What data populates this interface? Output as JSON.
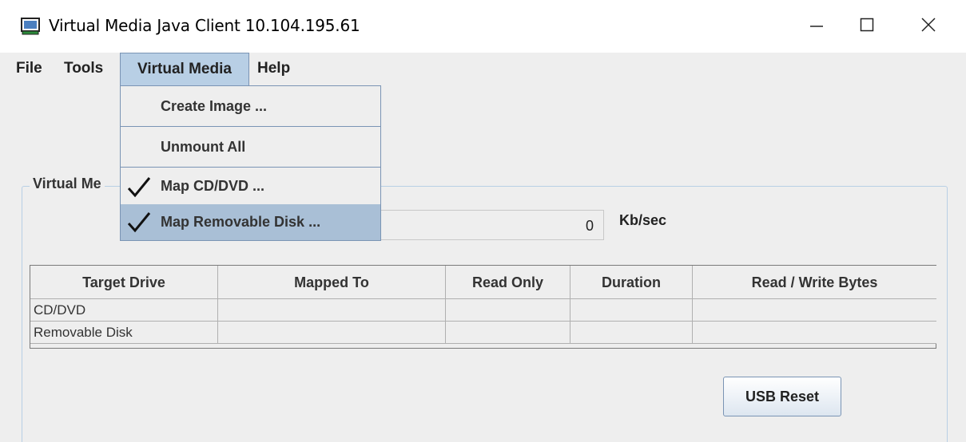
{
  "window": {
    "title": "Virtual Media Java Client 10.104.195.61"
  },
  "menubar": {
    "items": [
      {
        "label": "File"
      },
      {
        "label": "Tools"
      },
      {
        "label": "Virtual Media"
      },
      {
        "label": "Help"
      }
    ]
  },
  "dropdown": {
    "items": [
      {
        "label": "Create Image ...",
        "checked": false
      },
      {
        "label": "Unmount All",
        "checked": false
      },
      {
        "label": "Map CD/DVD ...",
        "checked": true
      },
      {
        "label": "Map Removable Disk ...",
        "checked": true,
        "highlighted": true
      }
    ]
  },
  "group": {
    "title": "Virtual Me"
  },
  "transfer": {
    "rate": "0",
    "unit": "Kb/sec"
  },
  "table": {
    "columns": [
      "Target Drive",
      "Mapped To",
      "Read Only",
      "Duration",
      "Read / Write Bytes"
    ],
    "rows": [
      [
        "CD/DVD",
        "",
        "",
        "",
        ""
      ],
      [
        "Removable Disk",
        "",
        "",
        "",
        ""
      ]
    ]
  },
  "buttons": {
    "usb_reset": "USB Reset"
  },
  "colors": {
    "menu_highlight": "#b8cfe5",
    "menu_border": "#7a94b4",
    "background": "#eeeeee"
  },
  "icons": {
    "app": "monitor-icon",
    "minimize": "minimize-icon",
    "maximize": "maximize-icon",
    "close": "close-icon",
    "check": "checkmark-icon"
  }
}
